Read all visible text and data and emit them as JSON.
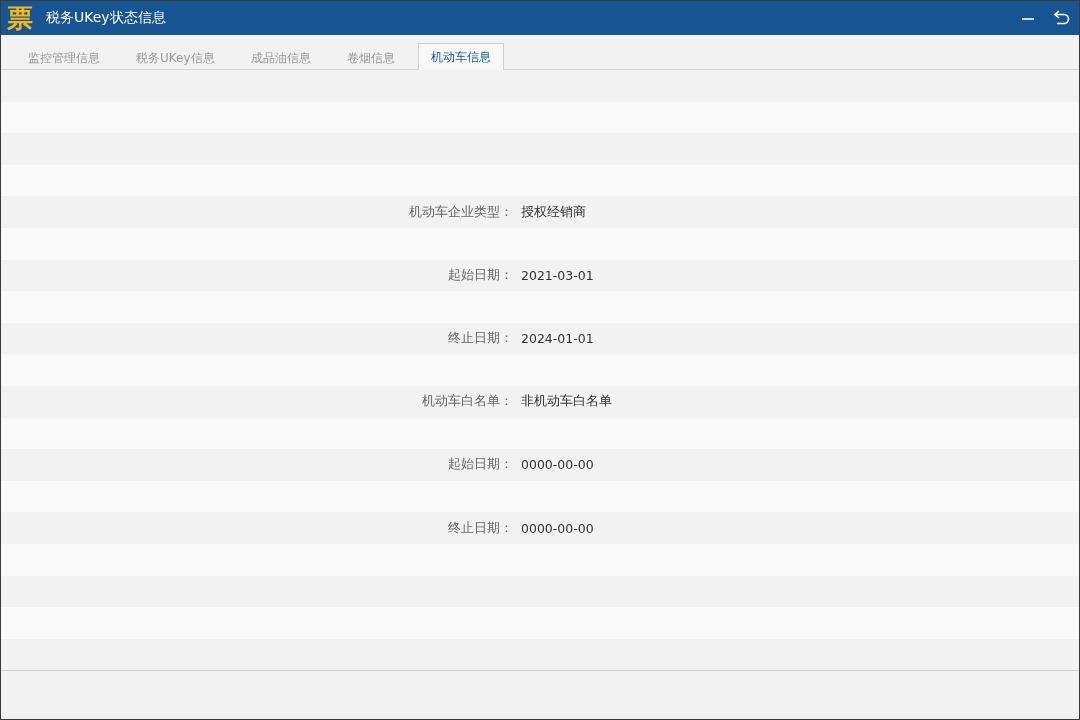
{
  "window": {
    "logo": "票",
    "title": "税务UKey状态信息"
  },
  "tabs": [
    {
      "label": "监控管理信息",
      "selected": false
    },
    {
      "label": "税务UKey信息",
      "selected": false
    },
    {
      "label": "成品油信息",
      "selected": false
    },
    {
      "label": "卷烟信息",
      "selected": false
    },
    {
      "label": "机动车信息",
      "selected": true
    }
  ],
  "fields": [
    {
      "label": "机动车企业类型：",
      "value": "授权经销商"
    },
    {
      "label": "起始日期：",
      "value": "2021-03-01"
    },
    {
      "label": "终止日期：",
      "value": "2024-01-01"
    },
    {
      "label": "机动车白名单：",
      "value": "非机动车白名单"
    },
    {
      "label": "起始日期：",
      "value": "0000-00-00"
    },
    {
      "label": "终止日期：",
      "value": "0000-00-00"
    }
  ]
}
